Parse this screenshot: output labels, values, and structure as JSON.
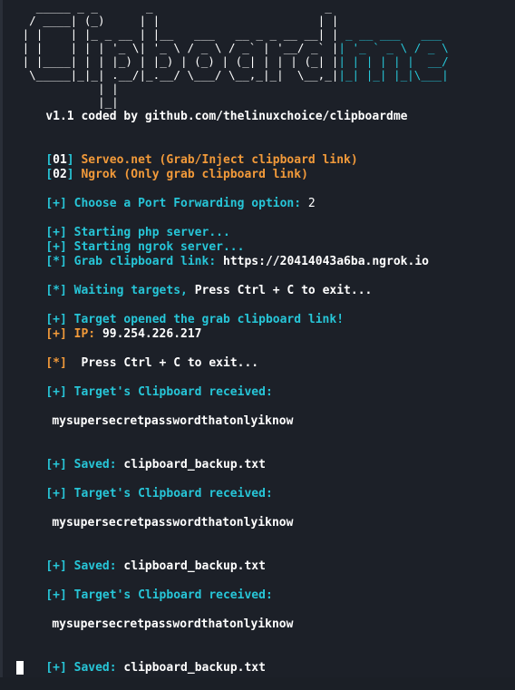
{
  "banner": {
    "left": [
      "   _____ _ _       _                         _",
      "  / ____| (_)     | |                       | |",
      " | |    | |_ _ __ | |__   ___   __ _ _ __ __| |",
      " | |    | | | '_ \\| '_ \\ / _ \\ / _` | '__/ _` |",
      " | |____| | | |_) | |_) | (_) | (_| | | | (_| |",
      "  \\_____|_|_| .__/|_.__/ \\___/ \\__,_|_|  \\__,_|",
      "            | |",
      "            |_|"
    ],
    "right": [
      "",
      "",
      " _ __ ___   ___",
      "| '_ ` _ \\ / _ \\",
      "| | | | | |  __/",
      "|_| |_| |_|\\___|",
      "",
      ""
    ],
    "version_line": "v1.1 coded by github.com/thelinuxchoice/clipboardme"
  },
  "menu": [
    {
      "num": "01",
      "text": "Serveo.net (Grab/Inject clipboard link)"
    },
    {
      "num": "02",
      "text": "Ngrok (Only grab clipboard link)"
    }
  ],
  "log": {
    "choose_prefix": "[+]",
    "choose_text": "Choose a Port Forwarding option:",
    "choose_value": "2",
    "php_prefix": "[+]",
    "php_text": "Starting php server...",
    "ngrok_prefix": "[+]",
    "ngrok_text": "Starting ngrok server...",
    "grab_prefix": "[*]",
    "grab_label": "Grab clipboard link:",
    "grab_url": "https://20414043a6ba.ngrok.io",
    "wait_prefix": "[*]",
    "wait_text": "Waiting targets,",
    "wait_hint": "Press Ctrl + C to exit...",
    "opened_prefix": "[+]",
    "opened_text": "Target opened the grab clipboard link!",
    "ip_prefix": "[+]",
    "ip_label": "IP:",
    "ip_value": "99.254.226.217",
    "exit_prefix": "[*]",
    "exit_text": "Press Ctrl + C to exit...",
    "received_prefix": "[+]",
    "received_text": "Target's Clipboard received:",
    "clipboard_value": "mysupersecretpasswordthatonlyiknow",
    "saved_prefix": "[+]",
    "saved_label": "Saved:",
    "saved_file": "clipboard_backup.txt"
  },
  "colors": {
    "background": "#1c2028",
    "cyan": "#27c6d8",
    "orange": "#f29a3a",
    "white": "#ffffff"
  }
}
